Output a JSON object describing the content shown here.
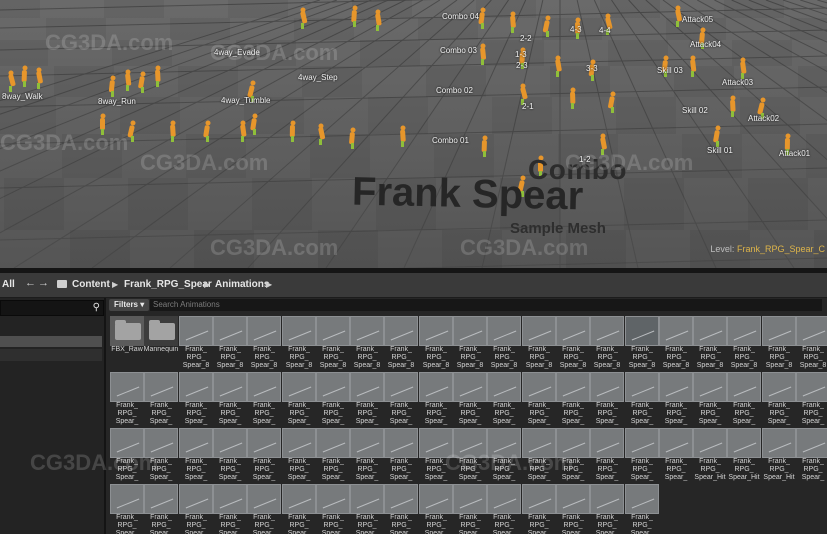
{
  "viewport": {
    "big_text": {
      "combo": "Combo",
      "frank": "Frank Spear",
      "sample": "Sample Mesh"
    },
    "level_prefix": "Level:",
    "level_name": "Frank_RPG_Spear_C",
    "labels": [
      "Combo 04",
      "Combo 03",
      "Combo 02",
      "Combo 01",
      "8way_Walk",
      "8way_Run",
      "4way_Evade",
      "4way_Step",
      "4way_Tumble",
      "2-2",
      "2-3",
      "2-1",
      "1-3",
      "1-2",
      "4-3",
      "4-4",
      "3-3",
      "Skill 03",
      "Skill 02",
      "Skill 01",
      "Attack05",
      "Attack04",
      "Attack03",
      "Attack02",
      "Attack01"
    ],
    "watermarks": [
      "CG3DA.com",
      "CG3DA.com",
      "CG3DA.com",
      "CG3DA.com",
      "CG3DA.com",
      "CG3DA.com",
      "CG3DA.com",
      "CG3DA.com",
      "CG3DA.com"
    ]
  },
  "pathbar": {
    "all_label": "All",
    "crumbs": [
      "Content",
      "Frank_RPG_Spear",
      "Animations"
    ]
  },
  "filters": {
    "label": "Filters ▾",
    "search_placeholder": "Search Animations"
  },
  "assets": {
    "rows": [
      [
        "FBX_Raw",
        "Mannequin",
        "Frank_\nRPG_\nSpear_8",
        "Frank_\nRPG_\nSpear_8",
        "Frank_\nRPG_\nSpear_8",
        "Frank_\nRPG_\nSpear_8",
        "Frank_\nRPG_\nSpear_8",
        "Frank_\nRPG_\nSpear_8",
        "Frank_\nRPG_\nSpear_8",
        "Frank_\nRPG_\nSpear_8",
        "Frank_\nRPG_\nSpear_8",
        "Frank_\nRPG_\nSpear_8",
        "Frank_\nRPG_\nSpear_8",
        "Frank_\nRPG_\nSpear_8",
        "Frank_\nRPG_\nSpear_8",
        "Frank_\nRPG_\nSpear_8",
        "Frank_\nRPG_\nSpear_8",
        "Frank_\nRPG_\nSpear_8",
        "Frank_\nRPG_\nSpear_8",
        "Frank_\nRPG_\nSpear_8",
        "Frank_\nRPG_\nSpear_8"
      ],
      [
        "Frank_\nRPG_\nSpear_",
        "Frank_\nRPG_\nSpear_",
        "Frank_\nRPG_\nSpear_",
        "Frank_\nRPG_\nSpear_",
        "Frank_\nRPG_\nSpear_",
        "Frank_\nRPG_\nSpear_",
        "Frank_\nRPG_\nSpear_",
        "Frank_\nRPG_\nSpear_",
        "Frank_\nRPG_\nSpear_",
        "Frank_\nRPG_\nSpear_",
        "Frank_\nRPG_\nSpear_",
        "Frank_\nRPG_\nSpear_",
        "Frank_\nRPG_\nSpear_",
        "Frank_\nRPG_\nSpear_",
        "Frank_\nRPG_\nSpear_",
        "Frank_\nRPG_\nSpear_",
        "Frank_\nRPG_\nSpear_",
        "Frank_\nRPG_\nSpear_",
        "Frank_\nRPG_\nSpear_",
        "Frank_\nRPG_\nSpear_",
        "Frank_\nRPG_\nSpear_"
      ],
      [
        "Frank_\nRPG_\nSpear_",
        "Frank_\nRPG_\nSpear_",
        "Frank_\nRPG_\nSpear_",
        "Frank_\nRPG_\nSpear_",
        "Frank_\nRPG_\nSpear_",
        "Frank_\nRPG_\nSpear_",
        "Frank_\nRPG_\nSpear_",
        "Frank_\nRPG_\nSpear_",
        "Frank_\nRPG_\nSpear_",
        "Frank_\nRPG_\nSpear_",
        "Frank_\nRPG_\nSpear_",
        "Frank_\nRPG_\nSpear_",
        "Frank_\nRPG_\nSpear_",
        "Frank_\nRPG_\nSpear_",
        "Frank_\nRPG_\nSpear_",
        "Frank_\nRPG_\nSpear_",
        "Frank_\nRPG_\nSpear_",
        "Frank_\nRPG_\nSpear_Hit",
        "Frank_\nRPG_\nSpear_Hit",
        "Frank_\nRPG_\nSpear_Hit",
        "Frank_\nRPG_\nSpear_"
      ],
      [
        "Frank_\nRPG_\nSpear_",
        "Frank_\nRPG_\nSpear_",
        "Frank_\nRPG_\nSpear_",
        "Frank_\nRPG_\nSpear_",
        "Frank_\nRPG_\nSpear_",
        "Frank_\nRPG_\nSpear_",
        "Frank_\nRPG_\nSpear_",
        "Frank_\nRPG_\nSpear_",
        "Frank_\nRPG_\nSpear_",
        "Frank_\nRPG_\nSpear_",
        "Frank_\nRPG_\nSpear_",
        "Frank_\nRPG_\nSpear_",
        "Frank_\nRPG_\nSpear_",
        "Frank_\nRPG_\nSpear_",
        "Frank_\nRPG_\nSpear_",
        "Frank_\nRPG_\nSpear_"
      ]
    ]
  },
  "colors": {
    "character_accent": "#e7962b",
    "character_accent_alt": "#8fbf3a",
    "level_highlight": "#ddb44a"
  }
}
